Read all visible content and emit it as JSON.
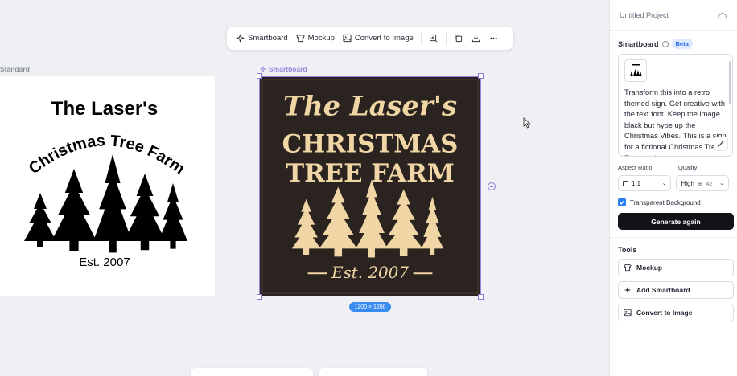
{
  "toolbar": {
    "smartboard_label": "Smartboard",
    "mockup_label": "Mockup",
    "convert_label": "Convert to Image"
  },
  "canvas": {
    "left_frame_label": "Standard",
    "right_frame_label": "Smartboard",
    "size_badge": "1200 × 1200",
    "accent_color": "#9b86e0"
  },
  "artwork_original": {
    "line1": "The Laser's",
    "line2": "Christmas Tree Farm",
    "line3": "Est. 2007"
  },
  "artwork_generated": {
    "line1": "The Laser's",
    "line2": "CHRISTMAS",
    "line3": "TREE FARM",
    "line4": "Est. 2007",
    "bg_color": "#2a2320",
    "ink_color": "#f0d6a4"
  },
  "panel": {
    "project_title": "Untitled Project",
    "smartboard_title": "Smartboard",
    "beta_badge": "Beta",
    "prompt_text": "Transform this into a retro themed sign. Get creative with the text font. Keep the image black but hype up the Christmas Vibes. This is a sign for a fictional Christmas Tree Farm and",
    "aspect_ratio_label": "Aspect Ratio",
    "quality_label": "Quality",
    "aspect_ratio_value": "1:1",
    "quality_value": "High",
    "quality_credits": "42",
    "transparent_bg_label": "Transparent Background",
    "transparent_bg_checked": true,
    "generate_label": "Generate again",
    "tools_title": "Tools",
    "tools": [
      {
        "label": "Mockup",
        "icon": "shirt-icon"
      },
      {
        "label": "Add Smartboard",
        "icon": "sparkle-icon"
      },
      {
        "label": "Convert to Image",
        "icon": "image-icon"
      }
    ]
  }
}
